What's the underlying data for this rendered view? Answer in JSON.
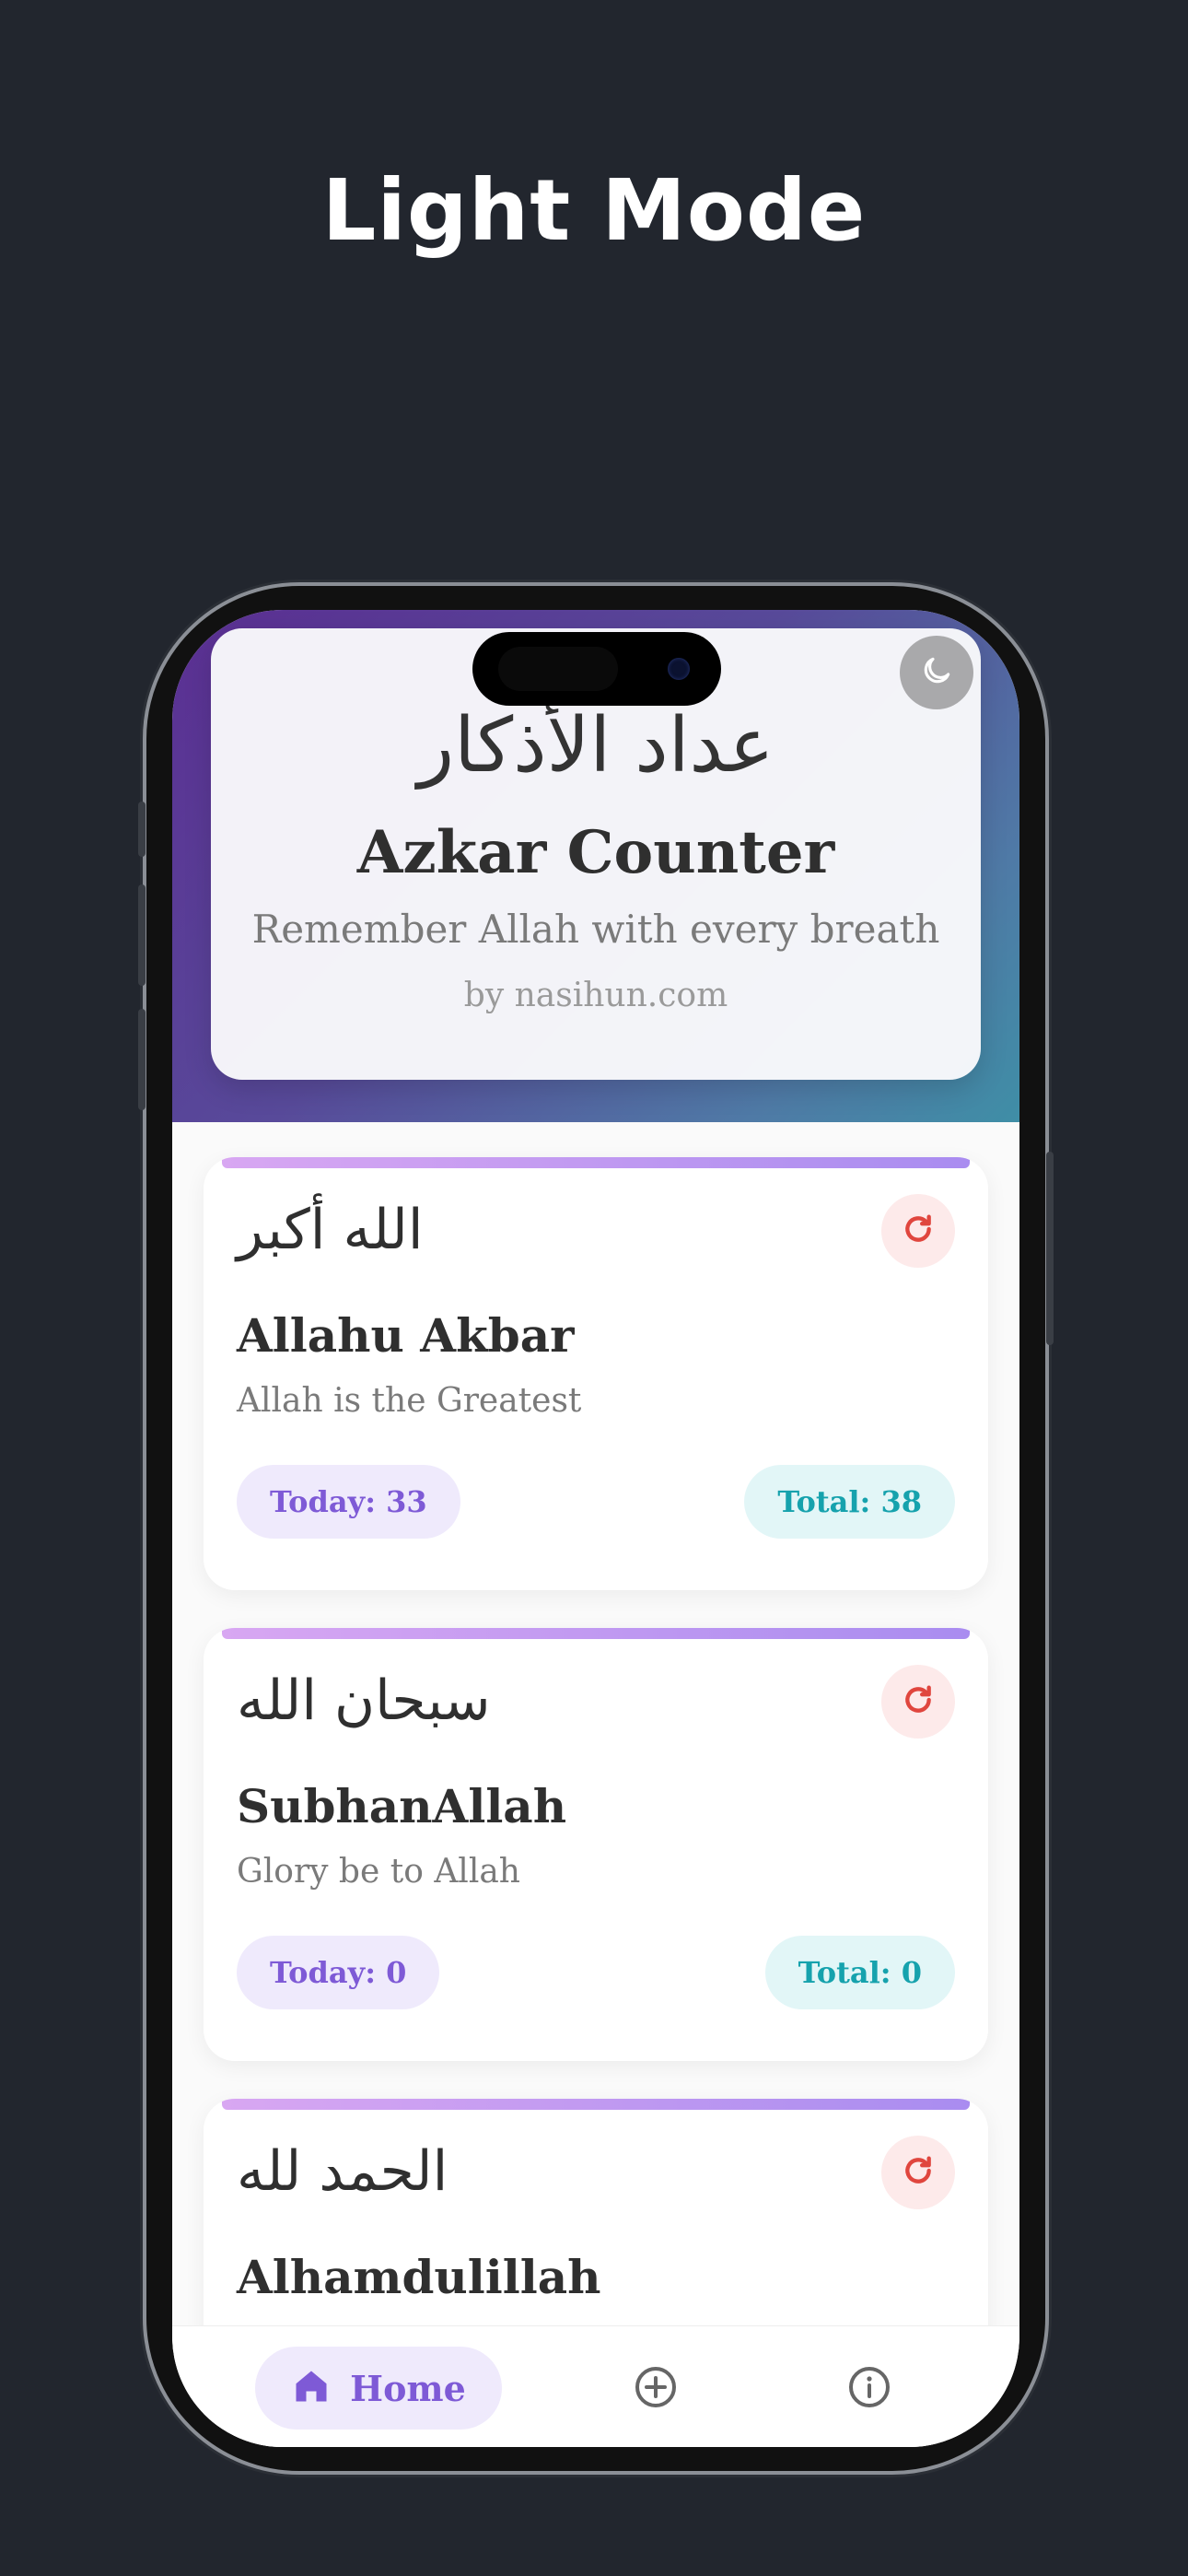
{
  "page_heading": "Light Mode",
  "app": {
    "header": {
      "arabic_title": "عداد الأذكار",
      "title": "Azkar Counter",
      "subtitle": "Remember Allah with every breath",
      "credit": "by nasihun.com",
      "theme_toggle_icon": "moon-icon"
    },
    "azkar": [
      {
        "arabic": "الله أكبر",
        "name": "Allahu Akbar",
        "meaning": "Allah is the Greatest",
        "today": "Today: 33",
        "total": "Total: 38"
      },
      {
        "arabic": "سبحان الله",
        "name": "SubhanAllah",
        "meaning": "Glory be to Allah",
        "today": "Today: 0",
        "total": "Total: 0"
      },
      {
        "arabic": "الحمد لله",
        "name": "Alhamdulillah"
      }
    ],
    "nav": {
      "home_label": "Home",
      "home_icon": "home-icon",
      "add_icon": "plus-circle-icon",
      "info_icon": "info-icon"
    }
  },
  "colors": {
    "background": "#22262e",
    "accent_purple": "#7e5ad6",
    "accent_teal": "#16a2ad",
    "reset_red": "#e0463e"
  }
}
